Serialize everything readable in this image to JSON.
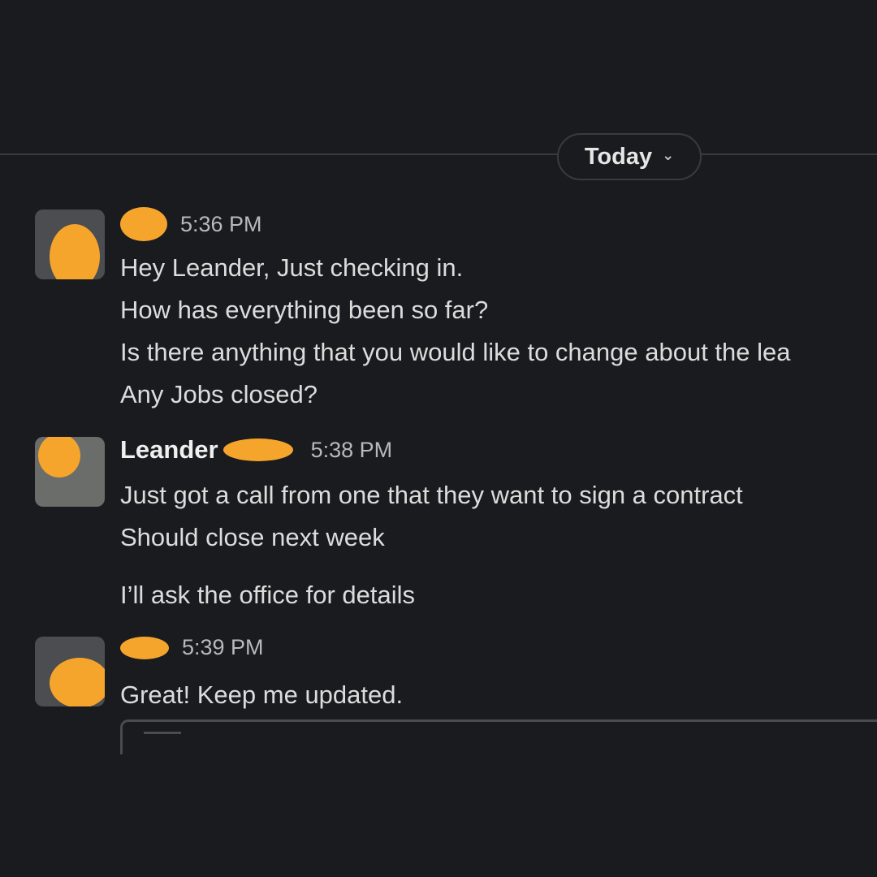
{
  "divider": {
    "label": "Today"
  },
  "messages": [
    {
      "time": "5:36 PM",
      "lines": [
        "Hey Leander, Just checking in.",
        " How has everything been so far?",
        "Is there anything that you would like to change about the lea",
        "Any Jobs closed?"
      ]
    },
    {
      "name": "Leander",
      "time": "5:38 PM",
      "lines": [
        "Just got a call from one that they want to sign a contract",
        "Should close next week",
        "I’ll ask the office for details"
      ]
    },
    {
      "time": "5:39 PM",
      "lines": [
        "Great! Keep me updated."
      ]
    }
  ],
  "colors": {
    "background": "#1a1b1e",
    "redaction": "#f6a52c",
    "divider": "#3a3b3e"
  }
}
